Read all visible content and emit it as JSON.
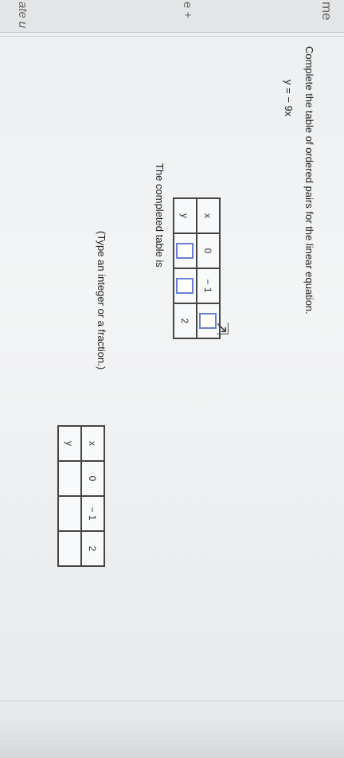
{
  "sidebar": {
    "fragment_top": "me",
    "fragment_mid": "e +",
    "fragment_bottom": "ate u"
  },
  "question": {
    "prompt": "Complete the table of ordered pairs for the linear equation.",
    "equation": "y = − 9x",
    "table_label": "The completed table is",
    "hint": "(Type an integer or a fraction.)"
  },
  "answer_table": {
    "headers": [
      "x",
      "y"
    ],
    "rows": [
      {
        "x": "0"
      },
      {
        "x": "− 1"
      },
      {
        "x": "2"
      }
    ]
  },
  "reference_table": {
    "headers": [
      "x",
      "y"
    ],
    "rows": [
      {
        "x": "0",
        "y": ""
      },
      {
        "x": "− 1",
        "y": ""
      },
      {
        "x": "2",
        "y": ""
      }
    ]
  }
}
